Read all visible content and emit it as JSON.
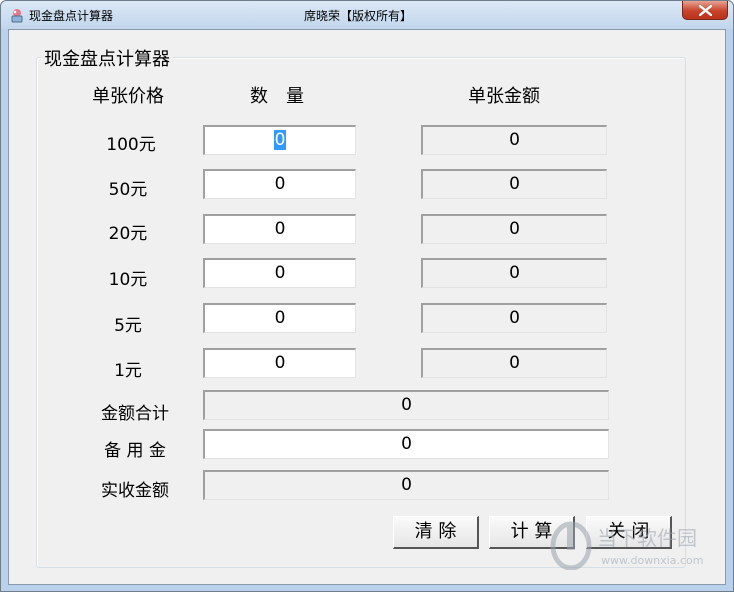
{
  "window": {
    "title": "现金盘点计算器",
    "center_text": "席晓荣【版权所有】"
  },
  "group": {
    "title": "现金盘点计算器",
    "headers": {
      "price": "单张价格",
      "quantity": "数　量",
      "amount": "单张金额"
    },
    "rows": [
      {
        "label": "100元",
        "quantity": "0",
        "amount": "0"
      },
      {
        "label": "50元",
        "quantity": "0",
        "amount": "0"
      },
      {
        "label": "20元",
        "quantity": "0",
        "amount": "0"
      },
      {
        "label": "10元",
        "quantity": "0",
        "amount": "0"
      },
      {
        "label": "5元",
        "quantity": "0",
        "amount": "0"
      },
      {
        "label": "1元",
        "quantity": "0",
        "amount": "0"
      }
    ],
    "total": {
      "label": "金额合计",
      "value": "0"
    },
    "reserve": {
      "label": "备 用 金",
      "value": "0"
    },
    "actual": {
      "label": "实收金额",
      "value": "0"
    }
  },
  "buttons": {
    "clear": "清 除",
    "calc": "计 算",
    "close": "关 闭"
  },
  "watermark": {
    "text": "当下软件园",
    "url": "www.downxia.com"
  },
  "colors": {
    "selection": "#3399ff",
    "close_button": "#c7432a",
    "frame": "#b9d1ea"
  }
}
